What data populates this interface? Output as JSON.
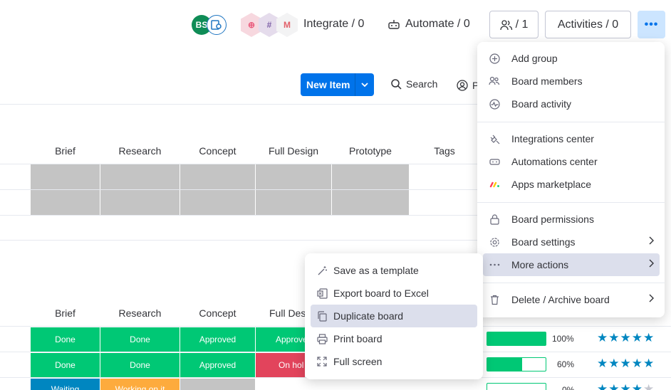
{
  "header": {
    "avatar_initials": "BS",
    "integrate_label": "Integrate / 0",
    "automate_label": "Automate / 0",
    "members_count": "/ 1",
    "activities_label": "Activities / 0",
    "more_glyph": "•••"
  },
  "toolbar": {
    "new_item_label": "New Item",
    "search_label": "Search",
    "person_label": "P"
  },
  "group1": {
    "columns": [
      "Brief",
      "Research",
      "Concept",
      "Full Design",
      "Prototype",
      "Tags"
    ]
  },
  "group2": {
    "columns": [
      "Brief",
      "Research",
      "Concept",
      "Full Des"
    ],
    "rows": [
      {
        "brief": "Done",
        "research": "Done",
        "concept": "Approved",
        "design": "Approve",
        "progress": 100,
        "progress_label": "100%",
        "rating": 5
      },
      {
        "brief": "Done",
        "research": "Done",
        "concept": "Approved",
        "design": "On hol",
        "progress": 60,
        "progress_label": "60%",
        "rating": 5
      },
      {
        "brief": "Waiting",
        "research": "Working on it",
        "concept": "",
        "design": "",
        "progress": 0,
        "progress_label": "0%",
        "rating": 4
      }
    ]
  },
  "menu": {
    "items": [
      {
        "label": "Add group",
        "icon": "plus-circle-icon"
      },
      {
        "label": "Board members",
        "icon": "people-icon"
      },
      {
        "label": "Board activity",
        "icon": "activity-icon"
      },
      {
        "label": "Integrations center",
        "icon": "plug-icon"
      },
      {
        "label": "Automations center",
        "icon": "robot-icon"
      },
      {
        "label": "Apps marketplace",
        "icon": "apps-logo-icon"
      },
      {
        "label": "Board permissions",
        "icon": "lock-icon"
      },
      {
        "label": "Board settings",
        "icon": "gear-icon"
      },
      {
        "label": "More actions",
        "icon": "dots-icon"
      },
      {
        "label": "Delete / Archive board",
        "icon": "trash-icon"
      }
    ]
  },
  "submenu": {
    "items": [
      {
        "label": "Save as a template",
        "icon": "magic-wand-icon"
      },
      {
        "label": "Export board to Excel",
        "icon": "excel-icon"
      },
      {
        "label": "Duplicate board",
        "icon": "duplicate-icon"
      },
      {
        "label": "Print board",
        "icon": "printer-icon"
      },
      {
        "label": "Full screen",
        "icon": "fullscreen-icon"
      }
    ]
  },
  "colors": {
    "primary": "#0073ea",
    "done": "#00c875",
    "stuck": "#e2445c",
    "working": "#0086c0",
    "orange": "#fdab3d",
    "menu_active": "#dcdfec"
  }
}
